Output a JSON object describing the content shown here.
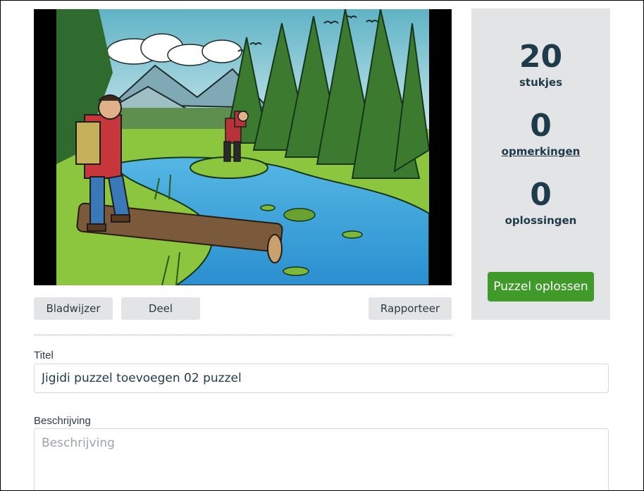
{
  "puzzle": {
    "image_alt": "Illustratie van wandelaars bij een rivier in het bos"
  },
  "actions": {
    "bookmark_label": "Bladwijzer",
    "share_label": "Deel",
    "report_label": "Rapporteer"
  },
  "stats": {
    "pieces_count": "20",
    "pieces_label": "stukjes",
    "comments_count": "0",
    "comments_label": "opmerkingen",
    "solutions_count": "0",
    "solutions_label": "oplossingen",
    "solve_button_label": "Puzzel oplossen",
    "accent_color": "#3f9a2a"
  },
  "form": {
    "title_label": "Titel",
    "title_value": "Jigidi puzzel toevoegen 02 puzzel",
    "description_label": "Beschrijving",
    "description_placeholder": "Beschrijving",
    "description_value": ""
  }
}
